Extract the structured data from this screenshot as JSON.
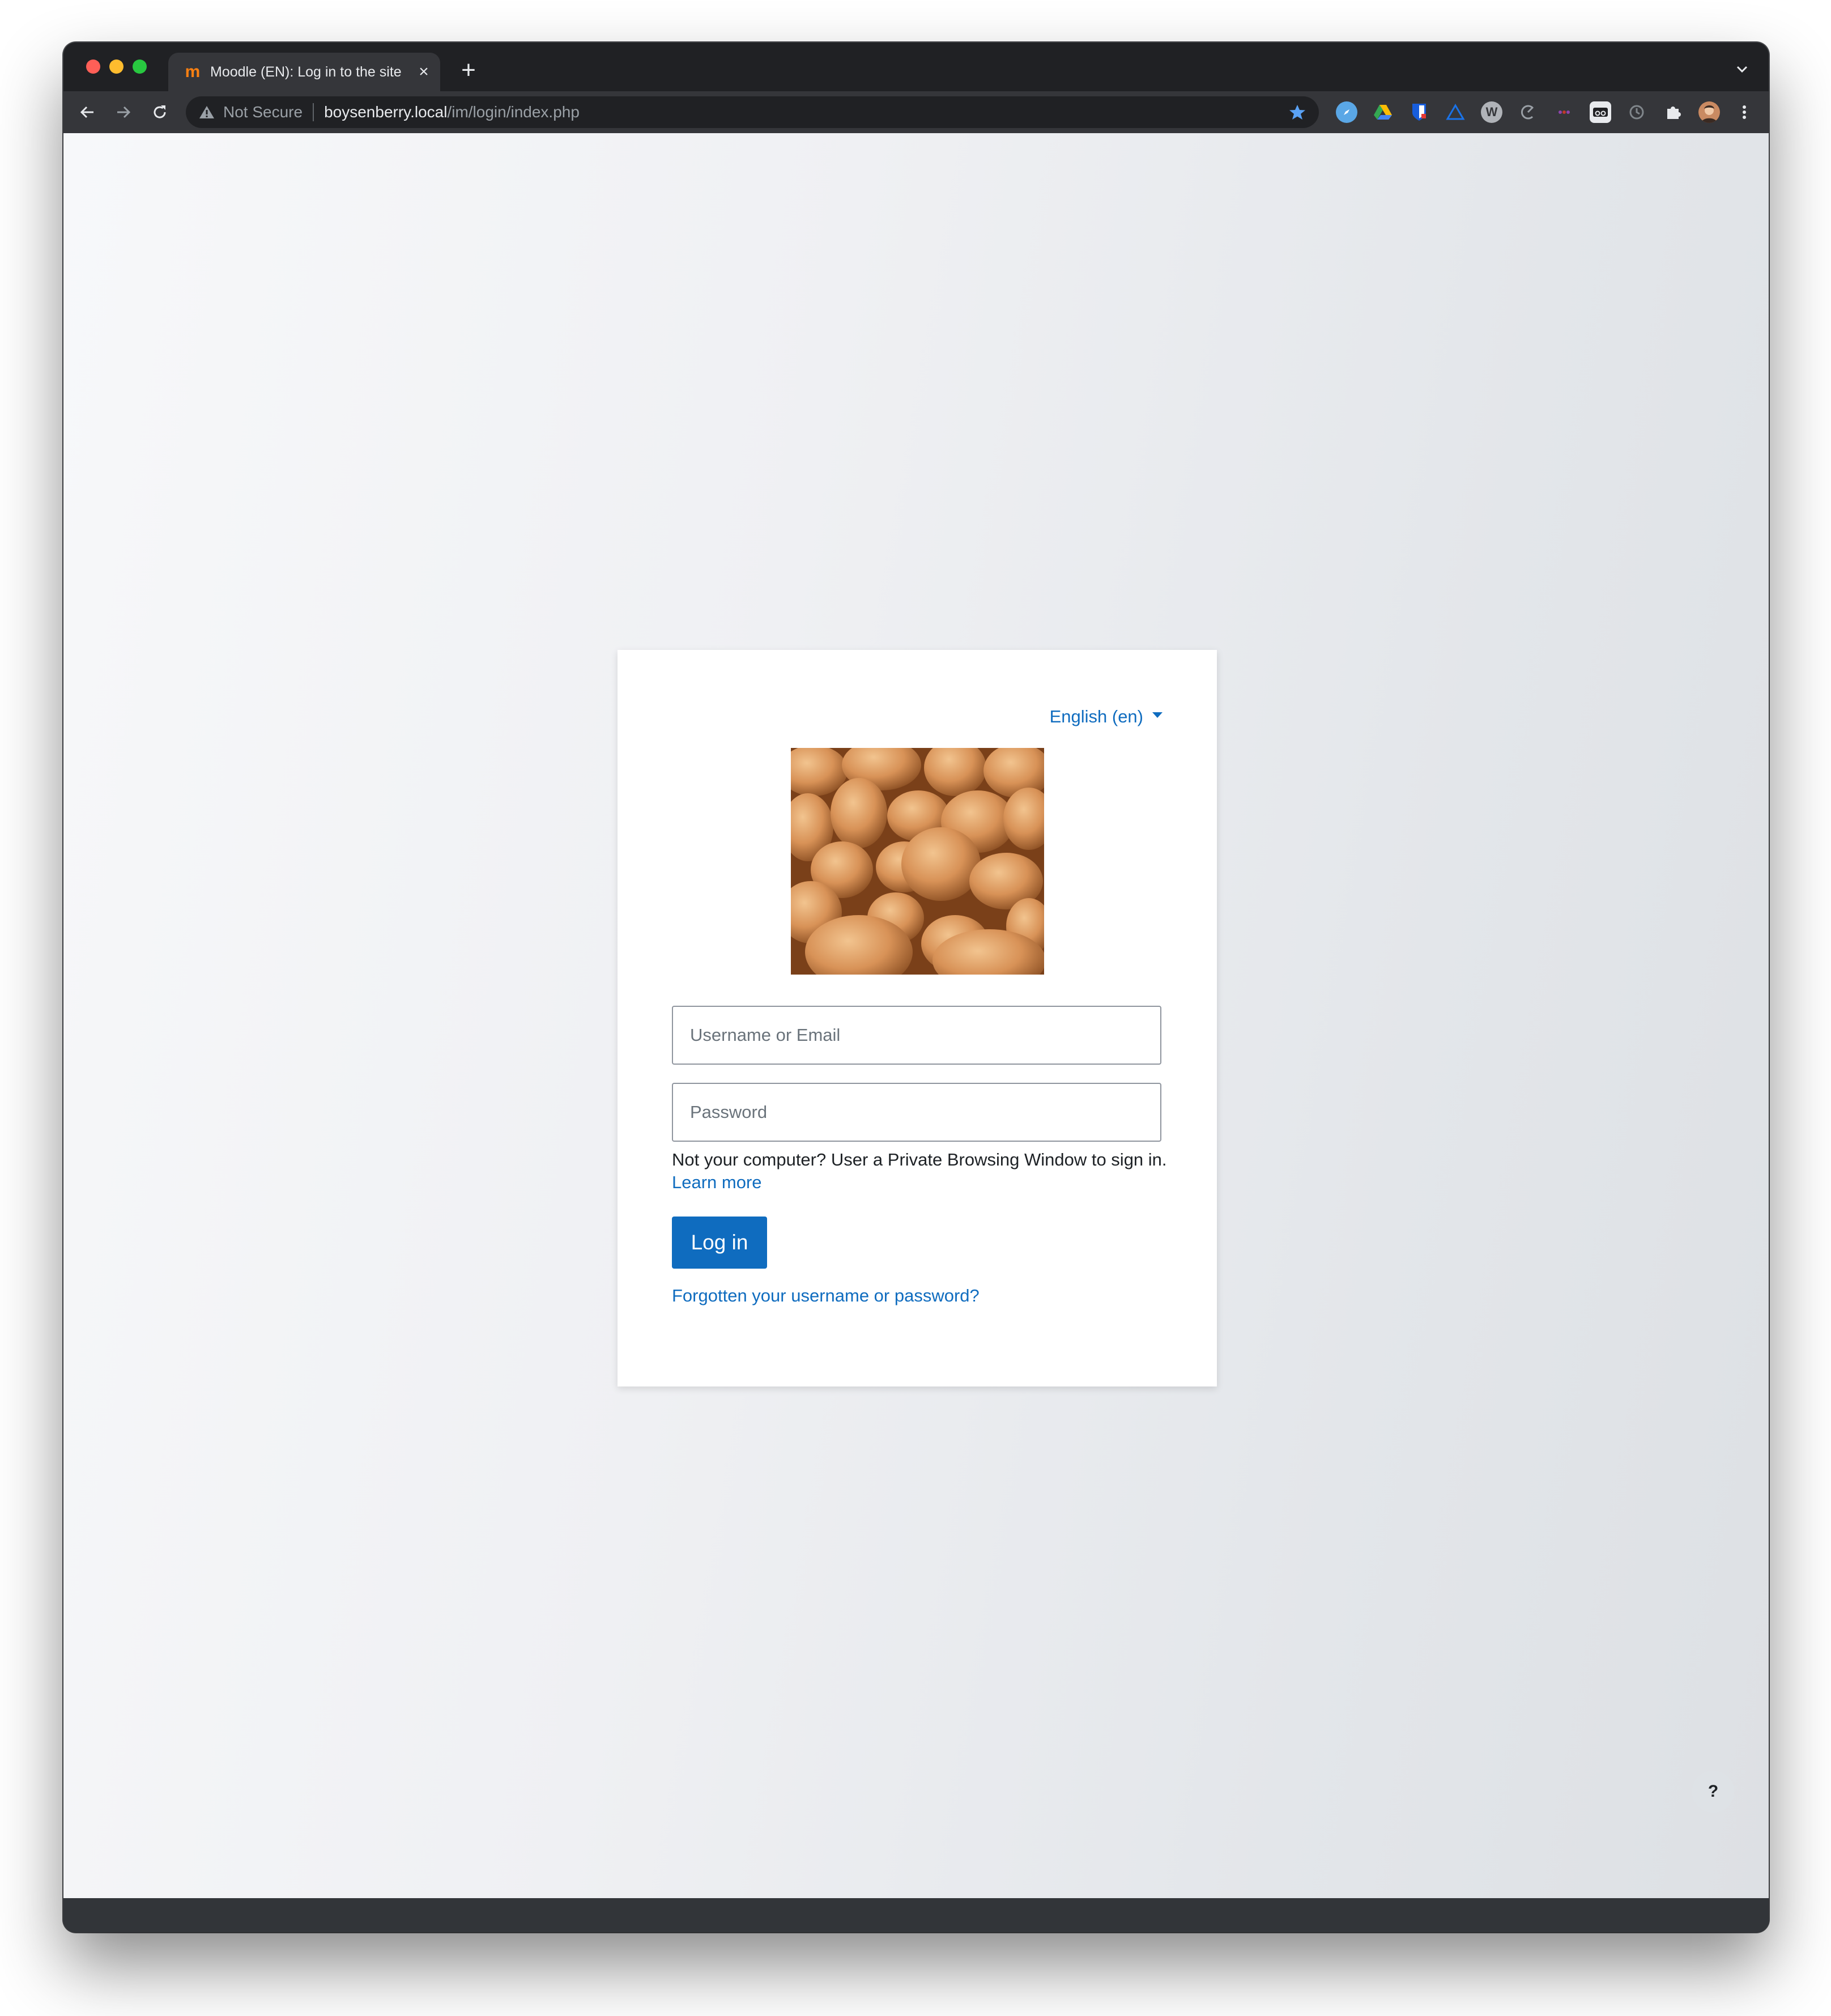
{
  "browser": {
    "tab": {
      "favicon_text": "m",
      "title": "Moodle (EN): Log in to the site",
      "close_icon": "close-icon"
    },
    "new_tab_symbol": "+",
    "omnibox": {
      "security_label": "Not Secure",
      "host": "boysenberry.local",
      "path": "/im/login/index.php"
    },
    "extensions": [
      {
        "name": "compass-extension-icon",
        "color": "#5aa7e6"
      },
      {
        "name": "google-drive-icon",
        "color": "#34a853"
      },
      {
        "name": "bitwarden-icon",
        "color": "#175ddc"
      },
      {
        "name": "triangle-extension-icon",
        "color": "#1a73e8"
      },
      {
        "name": "wordpress-icon",
        "color": "#b0b3b8"
      },
      {
        "name": "c-extension-icon",
        "color": "#9aa0a6"
      },
      {
        "name": "dots-extension-icon",
        "color": "#8e44ad"
      },
      {
        "name": "glasses-extension-icon",
        "color": "#e8eaed"
      },
      {
        "name": "clock-extension-icon",
        "color": "#80868b"
      },
      {
        "name": "puzzle-icon",
        "color": "#e8eaed"
      },
      {
        "name": "profile-avatar",
        "color": "#8d5a3b"
      },
      {
        "name": "more-menu-icon",
        "color": "#e8eaed"
      }
    ]
  },
  "login": {
    "language_selector": "English (en)",
    "logo_alt": "potatoes-logo-image",
    "username_placeholder": "Username or Email",
    "password_placeholder": "Password",
    "notice_text": "Not your computer? User a Private Browsing Window to sign in.",
    "learn_more": "Learn more",
    "login_button": "Log in",
    "forgot_link": "Forgotten your username or password?"
  },
  "help_button": "?",
  "colors": {
    "accent": "#0f6cbf",
    "window_chrome": "#202124",
    "toolbar": "#35363a"
  }
}
